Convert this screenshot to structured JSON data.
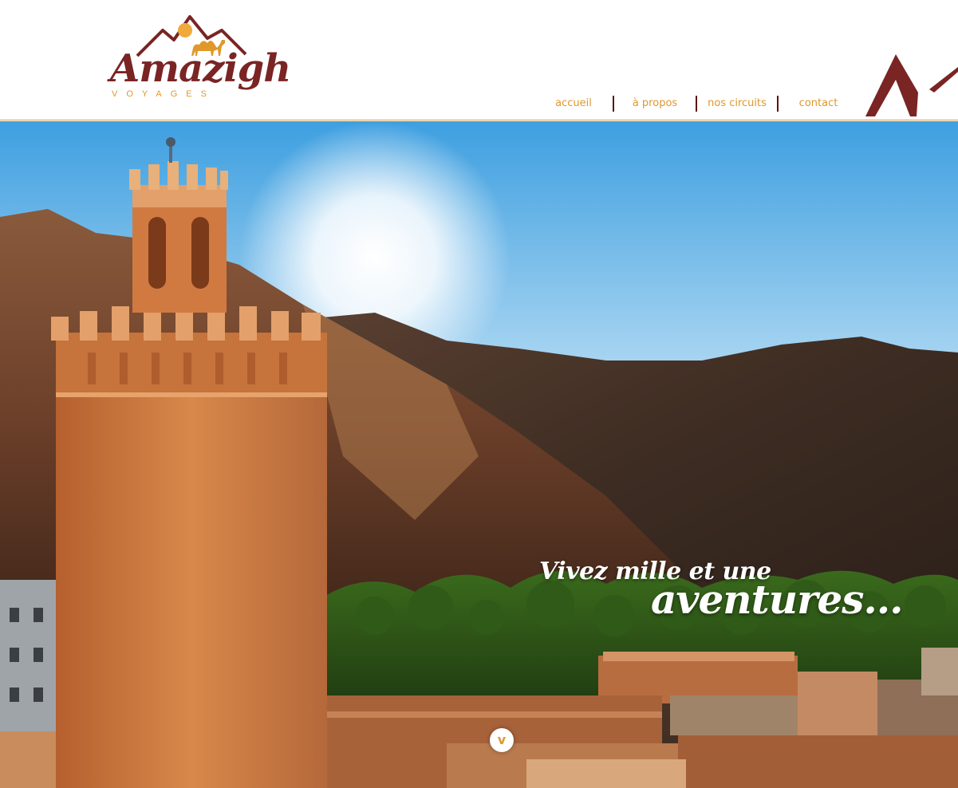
{
  "brand": {
    "name": "Amazigh",
    "tagline": "VOYAGES",
    "primary_color": "#7a2424",
    "accent_color": "#e0982b"
  },
  "nav": {
    "items": [
      {
        "label": "accueil"
      },
      {
        "label": "à propos"
      },
      {
        "label": "nos circuits"
      },
      {
        "label": "contact"
      }
    ]
  },
  "hero": {
    "line1": "Vivez mille et une",
    "line2": "aventures...",
    "scroll_icon": "chevron-down-icon",
    "scroll_glyph": "v"
  }
}
